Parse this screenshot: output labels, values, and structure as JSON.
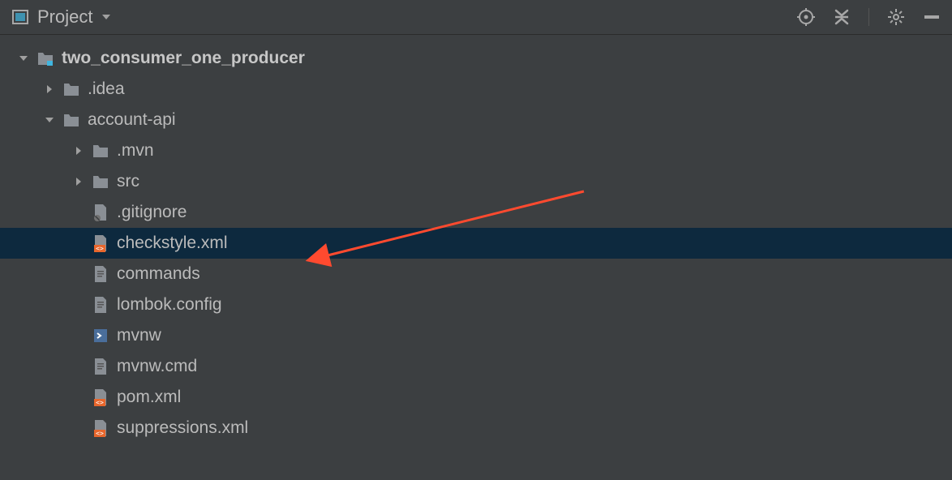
{
  "toolbar": {
    "title": "Project"
  },
  "tree": {
    "root": {
      "label": "two_consumer_one_producer",
      "icon": "module-folder",
      "expanded": true
    },
    "nodes": [
      {
        "label": ".idea",
        "icon": "folder",
        "indent": 1,
        "chevron": "right"
      },
      {
        "label": "account-api",
        "icon": "folder",
        "indent": 1,
        "chevron": "down"
      },
      {
        "label": ".mvn",
        "icon": "folder",
        "indent": 2,
        "chevron": "right"
      },
      {
        "label": "src",
        "icon": "folder",
        "indent": 2,
        "chevron": "right"
      },
      {
        "label": ".gitignore",
        "icon": "file-ignore",
        "indent": 2,
        "chevron": "none"
      },
      {
        "label": "checkstyle.xml",
        "icon": "file-xml",
        "indent": 2,
        "chevron": "none",
        "selected": true
      },
      {
        "label": "commands",
        "icon": "file-text",
        "indent": 2,
        "chevron": "none"
      },
      {
        "label": "lombok.config",
        "icon": "file-text",
        "indent": 2,
        "chevron": "none"
      },
      {
        "label": "mvnw",
        "icon": "file-sh",
        "indent": 2,
        "chevron": "none"
      },
      {
        "label": "mvnw.cmd",
        "icon": "file-text",
        "indent": 2,
        "chevron": "none"
      },
      {
        "label": "pom.xml",
        "icon": "file-xml",
        "indent": 2,
        "chevron": "none"
      },
      {
        "label": "suppressions.xml",
        "icon": "file-xml",
        "indent": 2,
        "chevron": "none"
      }
    ]
  }
}
